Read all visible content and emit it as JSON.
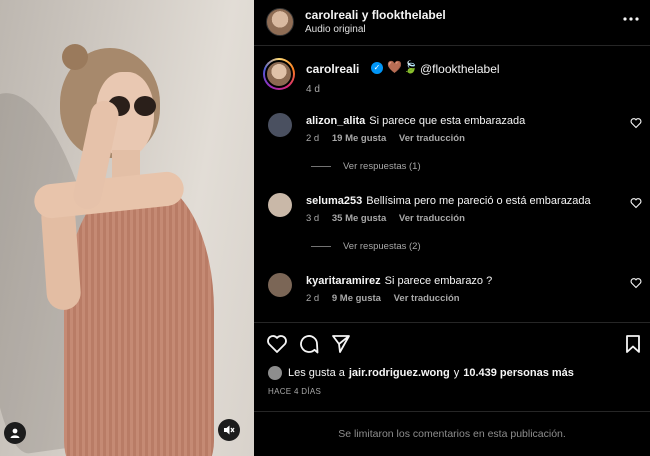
{
  "post": {
    "header_title": "carolreali y flookthelabel",
    "header_subtitle": "Audio original",
    "more_icon": "more-horizontal-icon"
  },
  "caption": {
    "username": "carolreali",
    "emojis": [
      "🤎",
      "🍃"
    ],
    "mention": "@flookthelabel",
    "time": "4 d"
  },
  "comments": [
    {
      "username": "alizon_alita",
      "text": "Si parece que esta embarazada",
      "time": "2 d",
      "likes": "19 Me gusta",
      "translate": "Ver traducción",
      "replies": "Ver respuestas (1)",
      "avatar_color": "#4a5060"
    },
    {
      "username": "seluma253",
      "text": "Bellísima pero me pareció o está embarazada",
      "time": "3 d",
      "likes": "35 Me gusta",
      "translate": "Ver traducción",
      "replies": "Ver respuestas (2)",
      "avatar_color": "#c9b8a8"
    },
    {
      "username": "kyaritaramirez",
      "text": "Si parece embarazo ?",
      "time": "2 d",
      "likes": "9 Me gusta",
      "translate": "Ver traducción",
      "replies": "",
      "avatar_color": "#7b6656"
    }
  ],
  "likes_summary": {
    "prefix": "Les gusta a",
    "user": "jair.rodriguez.wong",
    "joiner": "y",
    "others": "10.439 personas más"
  },
  "post_age": "HACE 4 DÍAS",
  "comments_limited": "Se limitaron los comentarios en esta publicación.",
  "colors": {
    "verified": "#0095f6",
    "muted_text": "#a8a8a8",
    "background": "#000000"
  }
}
